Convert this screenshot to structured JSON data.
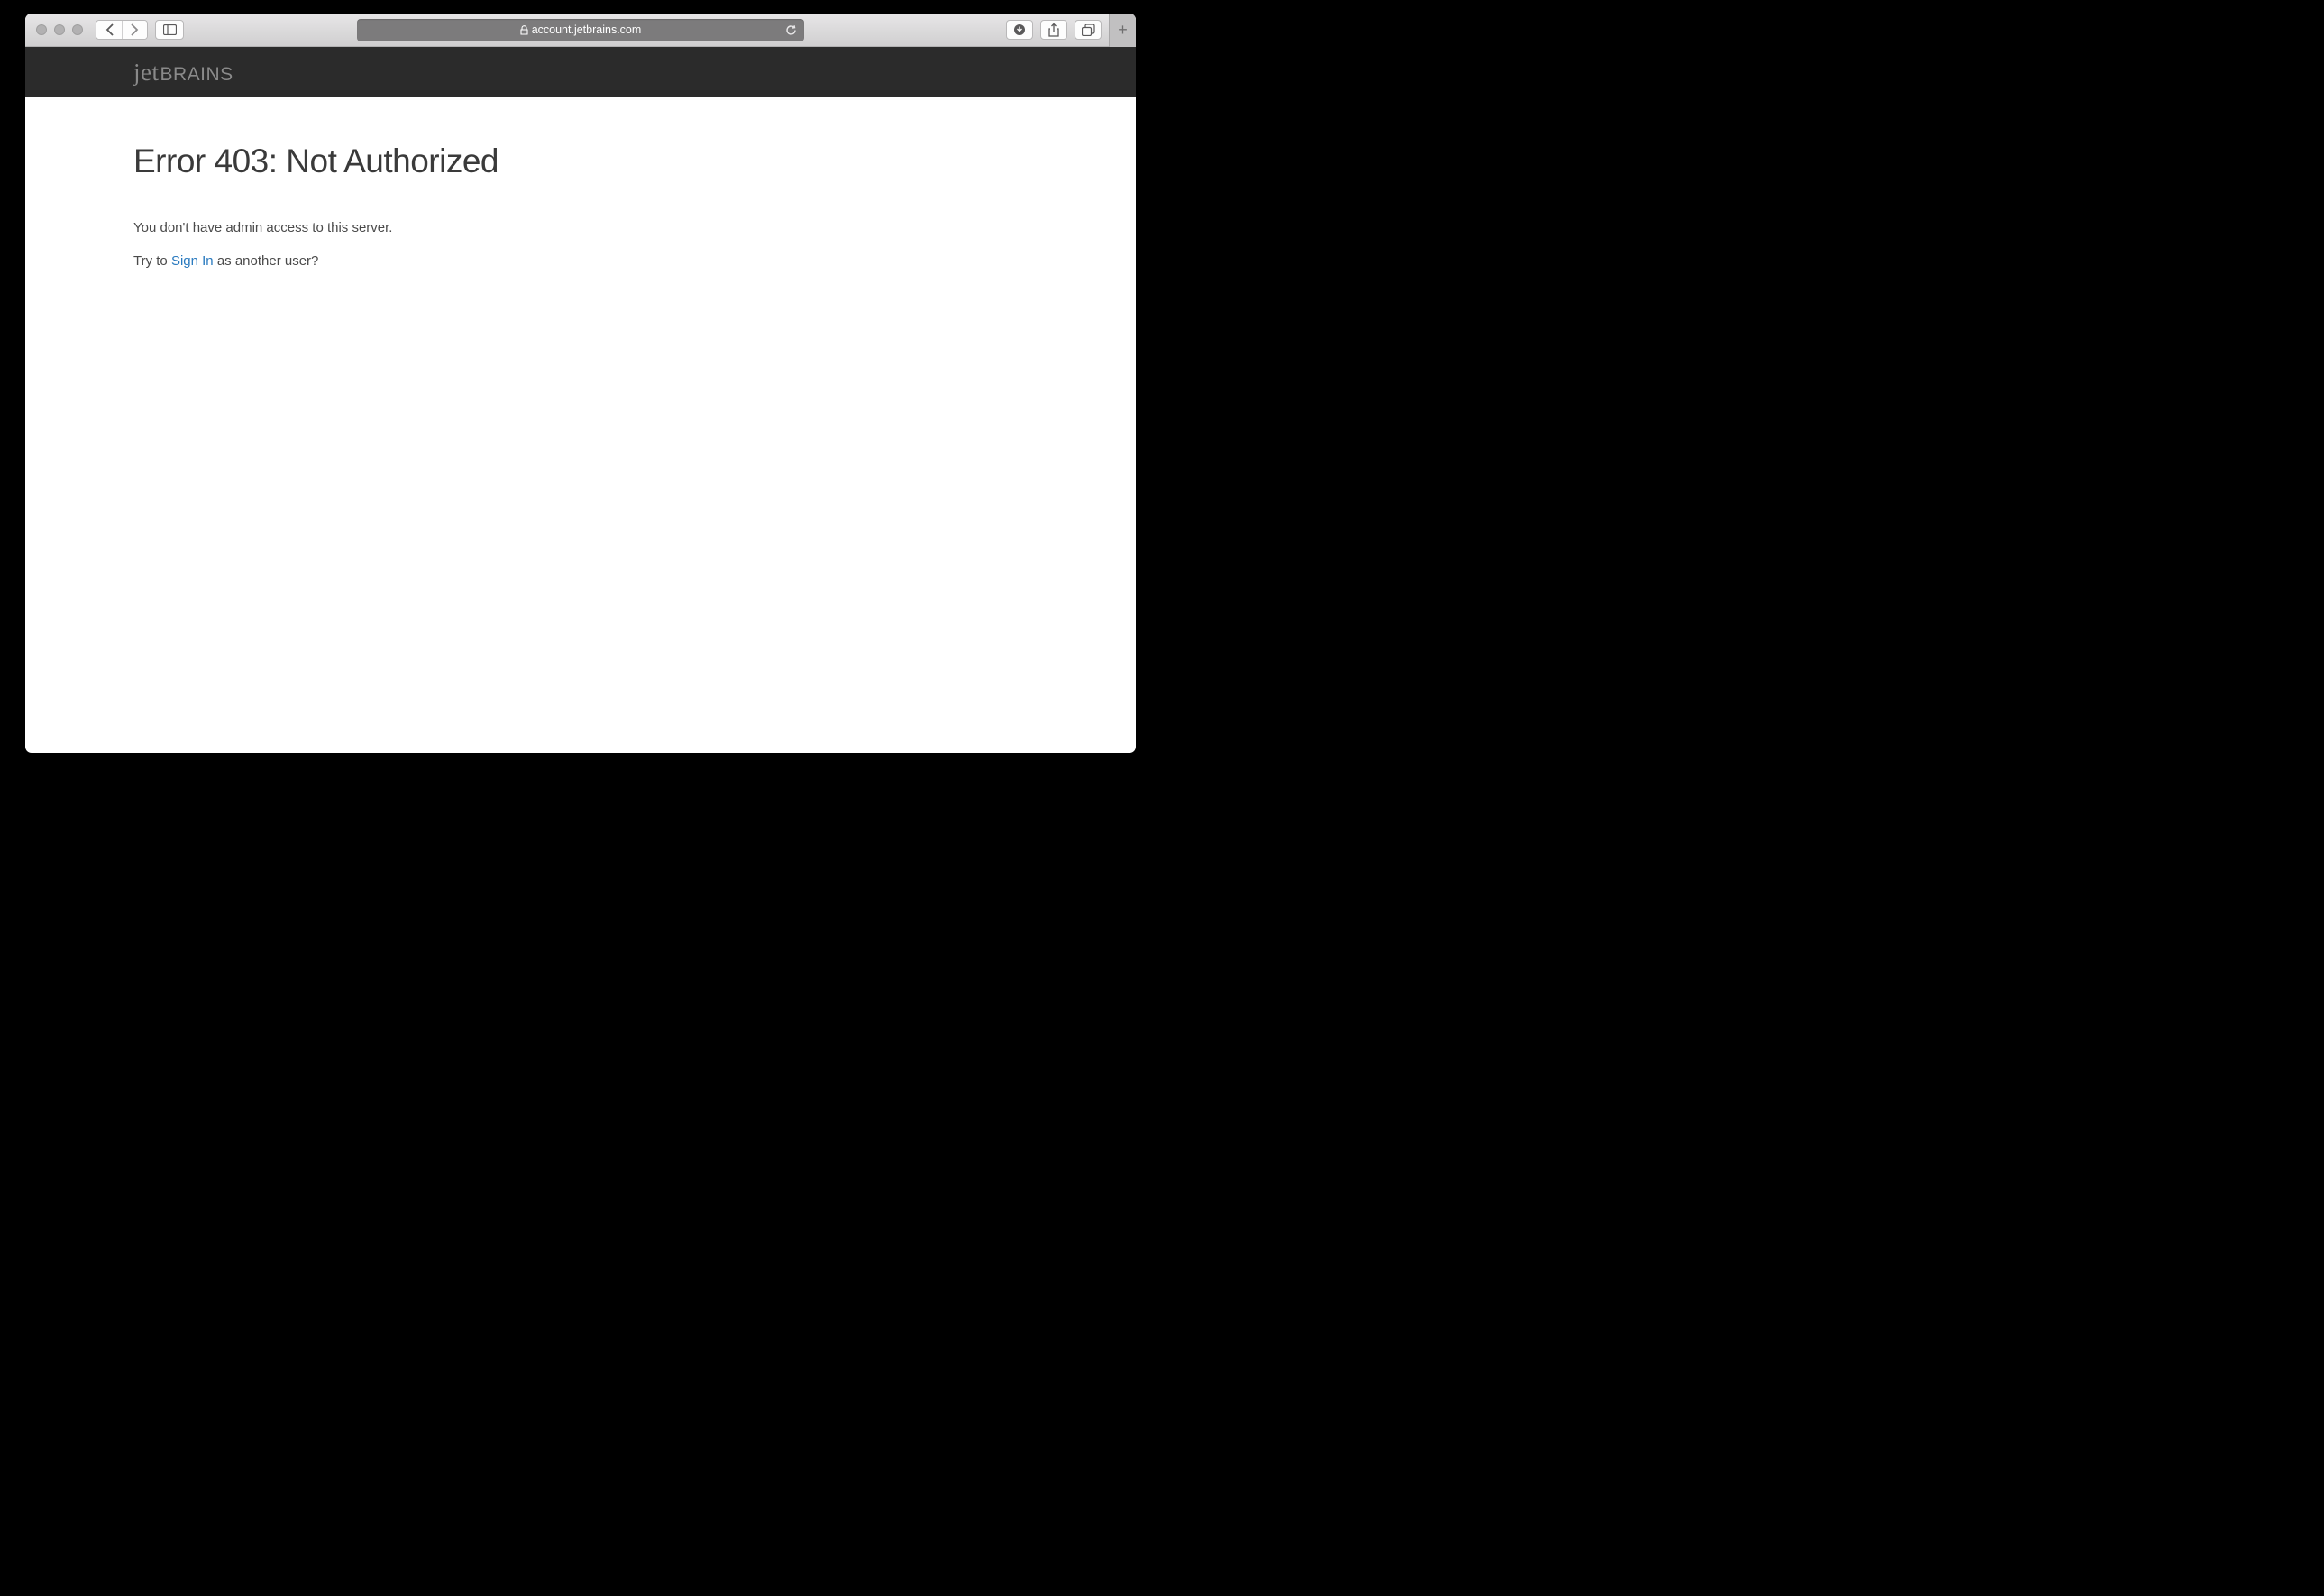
{
  "browser": {
    "url": "account.jetbrains.com"
  },
  "header": {
    "logo_script": "jet",
    "logo_caps": "BRAINS"
  },
  "page": {
    "heading": "Error 403: Not Authorized",
    "message": "You don't have admin access to this server.",
    "try_prefix": "Try to ",
    "signin_link": "Sign In",
    "try_suffix": " as another user?"
  }
}
